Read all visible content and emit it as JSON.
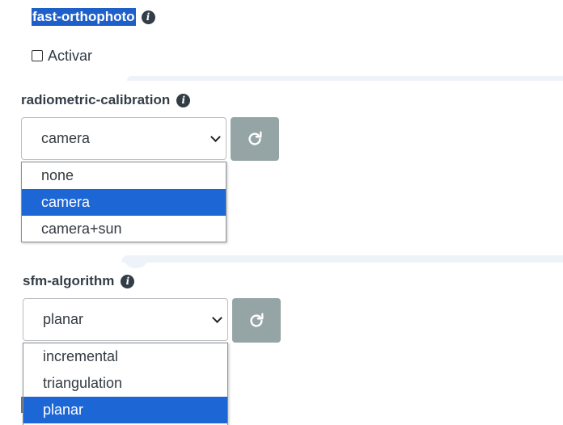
{
  "colors": {
    "selection_highlight": "#1f5fc9",
    "active_option": "#1d66d6",
    "refresh_button": "#95a5a6",
    "section_divider": "#eef2f9"
  },
  "fast_orthophoto": {
    "title": "fast-orthophoto",
    "info_icon": "info-circle-icon",
    "checkbox_label": "Activar",
    "checked": false
  },
  "radiometric_calibration": {
    "label": "radiometric-calibration",
    "info_icon": "info-circle-icon",
    "selected": "camera",
    "refresh_icon": "refresh-icon",
    "options": [
      "none",
      "camera",
      "camera+sun"
    ],
    "active_option": "camera"
  },
  "sfm_algorithm": {
    "label": "sfm-algorithm",
    "info_icon": "info-circle-icon",
    "selected": "planar",
    "refresh_icon": "refresh-icon",
    "options": [
      "incremental",
      "triangulation",
      "planar"
    ],
    "active_option": "planar"
  }
}
